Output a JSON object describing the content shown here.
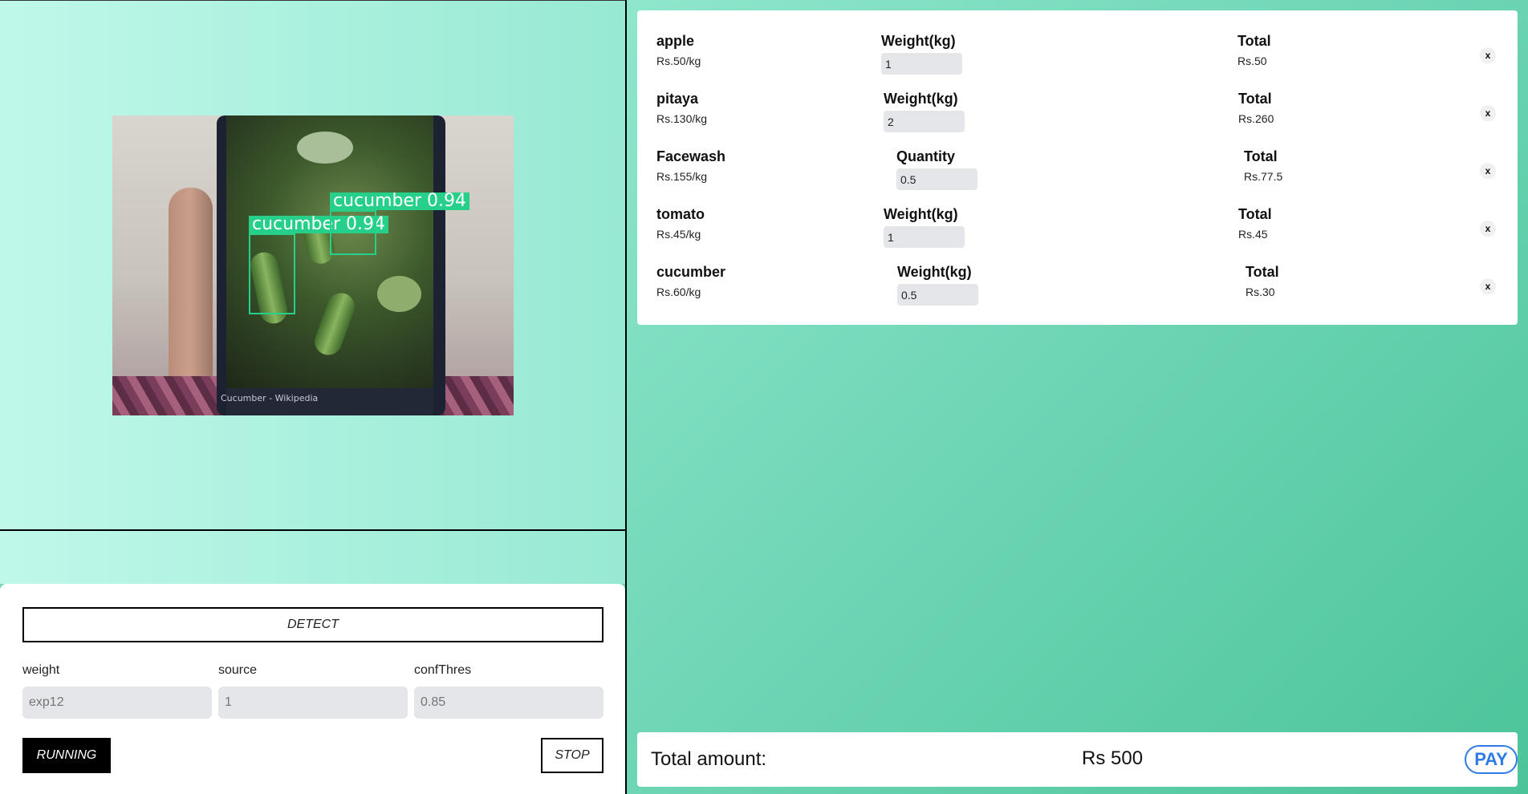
{
  "detection": {
    "labels": [
      "cucumber 0.94",
      "cucumber 0.94"
    ],
    "phone_caption": "Cucumber - Wikipedia",
    "box_color": "#27d08a"
  },
  "controls": {
    "detect_label": "DETECT",
    "fields": [
      {
        "label": "weight",
        "placeholder": "exp12"
      },
      {
        "label": "source",
        "placeholder": "1"
      },
      {
        "label": "confThres",
        "placeholder": "0.85"
      }
    ],
    "running_label": "RUNNING",
    "stop_label": "STOP"
  },
  "cart": {
    "items": [
      {
        "name": "apple",
        "price": "Rs.50/kg",
        "qty_label": "Weight(kg)",
        "qty": "1",
        "total_label": "Total",
        "total": "Rs.50"
      },
      {
        "name": "pitaya",
        "price": "Rs.130/kg",
        "qty_label": "Weight(kg)",
        "qty": "2",
        "total_label": "Total",
        "total": "Rs.260"
      },
      {
        "name": "Facewash",
        "price": "Rs.155/kg",
        "qty_label": "Quantity",
        "qty": "0.5",
        "total_label": "Total",
        "total": "Rs.77.5"
      },
      {
        "name": "tomato",
        "price": "Rs.45/kg",
        "qty_label": "Weight(kg)",
        "qty": "1",
        "total_label": "Total",
        "total": "Rs.45"
      },
      {
        "name": "cucumber",
        "price": "Rs.60/kg",
        "qty_label": "Weight(kg)",
        "qty": "0.5",
        "total_label": "Total",
        "total": "Rs.30"
      }
    ],
    "remove_label": "x"
  },
  "summary": {
    "total_label": "Total amount:",
    "total_value": "Rs 500",
    "pay_label": "PAY"
  },
  "colors": {
    "pay_accent": "#2f7be6",
    "panel_bg": "#6fd8b8"
  }
}
